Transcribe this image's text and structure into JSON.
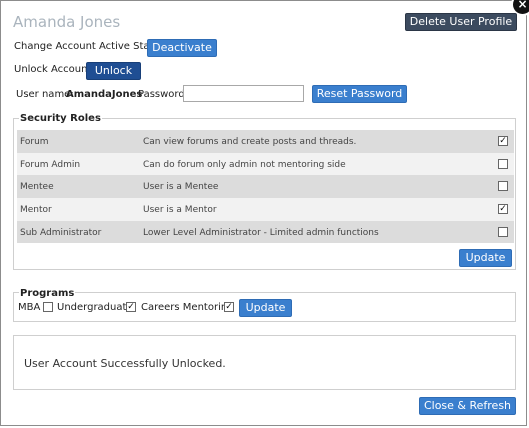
{
  "dialog": {
    "user_title": "Amanda Jones",
    "close_symbol": "×",
    "delete_button": "Delete User Profile"
  },
  "account": {
    "status_label": "Change Account Active Status -",
    "deactivate_button": "Deactivate",
    "unlock_label": "Unlock Account -",
    "unlock_button": "Unlock",
    "username_label": "User name:",
    "username_value": "AmandaJones",
    "password_label": "Password:",
    "password_value": "",
    "reset_password_button": "Reset Password"
  },
  "security_roles": {
    "legend": "Security Roles",
    "roles": [
      {
        "name": "Forum",
        "description": "Can view forums and create posts and threads.",
        "checked": true
      },
      {
        "name": "Forum Admin",
        "description": "Can do forum only admin not mentoring side",
        "checked": false
      },
      {
        "name": "Mentee",
        "description": "User is a Mentee",
        "checked": false
      },
      {
        "name": "Mentor",
        "description": "User is a Mentor",
        "checked": true
      },
      {
        "name": "Sub Administrator",
        "description": "Lower Level Administrator - Limited admin functions",
        "checked": false
      }
    ],
    "update_button": "Update"
  },
  "programs": {
    "legend": "Programs",
    "items": [
      {
        "label": "MBA",
        "checked": false
      },
      {
        "label": "Undergraduate",
        "checked": true
      },
      {
        "label": "Careers Mentoring",
        "checked": true
      }
    ],
    "update_button": "Update"
  },
  "message": {
    "text": "User Account Successfully Unlocked."
  },
  "footer": {
    "close_refresh_button": "Close & Refresh"
  },
  "icons": {
    "close": "close-icon",
    "checkmark": "checkmark-icon"
  }
}
